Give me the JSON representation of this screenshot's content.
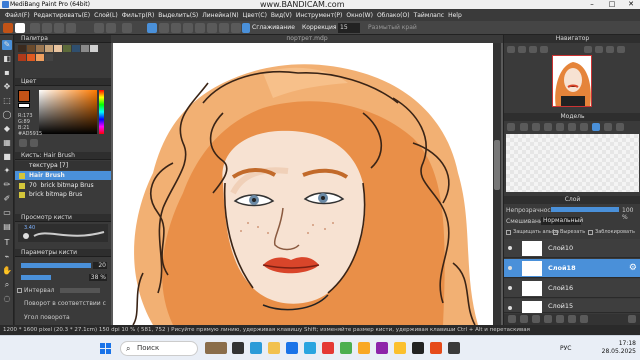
{
  "app": {
    "title": "MediBang Paint Pro (64bit)",
    "watermark": "www.BANDICAM.com",
    "doc_tab": "портрет.mdp"
  },
  "menu": [
    "Файл(F)",
    "Редактировать(E)",
    "Слой(L)",
    "Фильтр(R)",
    "Выделить(S)",
    "Линейка(N)",
    "Цвет(C)",
    "Вид(V)",
    "Инструмент(P)",
    "Окно(W)",
    "Облако(O)",
    "Таймлапс",
    "Help"
  ],
  "toolbar": {
    "smoothing_label": "Сглаживание",
    "correction_label": "Коррекция",
    "correction_value": "15",
    "blur_label": "Размытый край"
  },
  "panels": {
    "palette": "Палитра",
    "color": "Цвет",
    "color_values": {
      "r": "R:173",
      "g": "G:89",
      "b": "B:21",
      "hex": "#AD5915"
    },
    "brush": "Кисть: Hair Brush",
    "brush_group": "текстура [7]",
    "brushes": [
      {
        "size": "",
        "name": "Hair Brush"
      },
      {
        "size": "70",
        "name": "brick bitmap Brus"
      },
      {
        "size": "",
        "name": "brick bitmap Brus"
      }
    ],
    "brush_preview": "Просмотр кисти",
    "preview_size": "3.40",
    "brush_params": "Параметры кисти",
    "param_size": "20",
    "param_opacity": "38 %",
    "param_interval": "Интервал",
    "param_rotate": "Поворот в соответствии с",
    "param_angle": "Угол поворота"
  },
  "right": {
    "navigator": "Навигатор",
    "model": "Модель",
    "layer": "Слой",
    "opacity_label": "Непрозрачность",
    "opacity_value": "100 %",
    "blend_label": "Смешивание",
    "blend_value": "Нормальный",
    "protect_alpha": "Защищать альфа",
    "clip": "Вырезать",
    "lock": "Заблокировать",
    "layers": [
      "Слой10",
      "Слой18",
      "Слой16",
      "Слой15"
    ]
  },
  "status": "1200 * 1600 pixel   (20.3 * 27.1cm)   150 dpi   10 %   ( 581, 752 )   Рисуйте прямую линию, удерживая клавишу Shift; изменяйте размер кисти, удерживая клавиши Ctrl + Alt и перетаскивая",
  "taskbar": {
    "search": "Поиск",
    "lang": "РУС",
    "time": "17:18",
    "date": "28.05.2025"
  },
  "colors": {
    "accent": "#4a90d9",
    "brush_color": "#AD5915",
    "hair": "#e07a2a"
  }
}
